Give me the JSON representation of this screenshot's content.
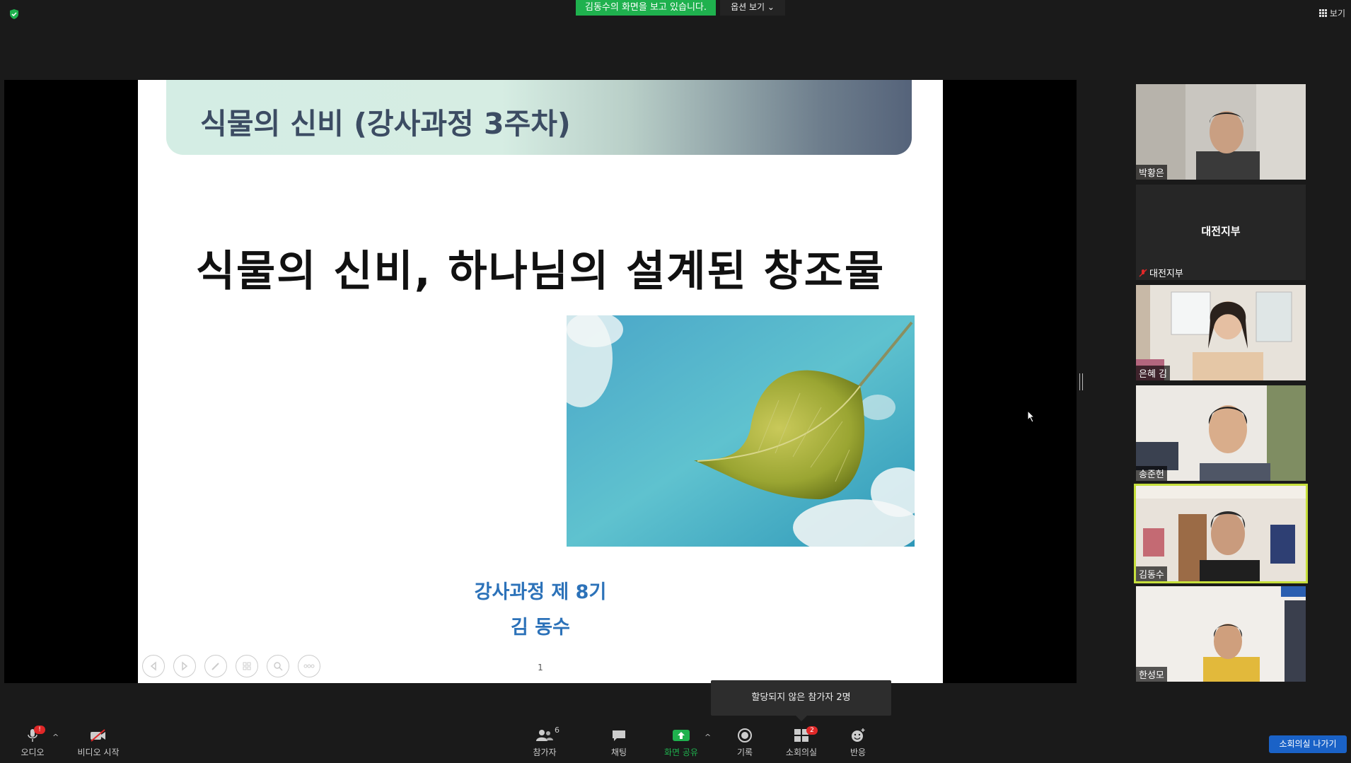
{
  "top_bar": {
    "viewing_banner": "김동수의 화면을 보고 있습니다.",
    "view_options": "옵션 보기 ⌄",
    "view_button": "보기",
    "security_icon": "shield-check-icon",
    "banner_color": "#1fb14e"
  },
  "slide": {
    "title": "식물의 신비 (강사과정 3주차)",
    "heading": "식물의 신비, 하나님의 설계된 창조물",
    "course": "강사과정 제 8기",
    "author": "김 동수",
    "page_number": "1",
    "image": "leaf-against-sky-image",
    "tools": [
      "prev-icon",
      "next-icon",
      "pen-icon",
      "slides-icon",
      "zoom-icon",
      "more-icon"
    ]
  },
  "participants": [
    {
      "name": "박황은",
      "video": true
    },
    {
      "name": "대전지부",
      "center_label": "대전지부",
      "video": false,
      "muted": true
    },
    {
      "name": "은혜 김",
      "video": true
    },
    {
      "name": "송준헌",
      "video": true
    },
    {
      "name": "김동수",
      "video": true,
      "speaking": true
    },
    {
      "name": "한성모",
      "video": true
    }
  ],
  "tooltip": "할당되지 않은 참가자 2명",
  "toolbar": {
    "audio": "오디오",
    "audio_badge": "!",
    "video": "비디오 시작",
    "participants": "참가자",
    "participants_count": "6",
    "chat": "채팅",
    "share": "화면 공유",
    "record": "기록",
    "breakout": "소회의실",
    "breakout_badge": "2",
    "reactions": "반응",
    "leave_breakout": "소회의실 나가기",
    "share_color": "#1fb14e",
    "leave_color": "#1a62c7"
  }
}
